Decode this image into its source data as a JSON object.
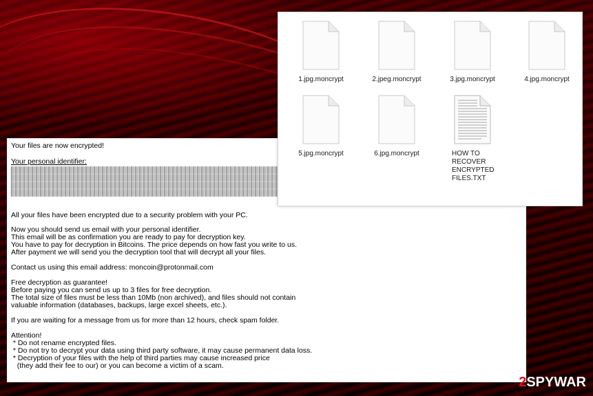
{
  "ransom_note": {
    "heading": "Your files are now encrypted!",
    "identifier_label": "Your personal identifier:",
    "paragraphs": [
      "All your files have been encrypted due to a security problem with your PC.",
      "Now you should send us email with your personal identifier.",
      "This email will be as confirmation you are ready to pay for decryption key.",
      "You have to pay for decryption in Bitcoins. The price depends on how fast you write to us.",
      "After payment we will send you the decryption tool that will decrypt all your files.",
      "Contact us using this email address: moncoin@protonmail.com",
      "Free decryption as guarantee!",
      "Before paying you can send us up to 3 files for free decryption.",
      "The total size of files must be less than 10Mb (non archived), and files should not contain",
      "valuable information (databases, backups, large excel sheets, etc.).",
      "If you are waiting for a message from us for more than 12 hours, check spam folder.",
      "Attention!",
      " * Do not rename encrypted files.",
      " * Do not try to decrypt your data using third party software, it may cause permanent data loss.",
      " * Decryption of your files with the help of third parties may cause increased price",
      "   (they add their fee to our) or you can become a victim of a scam."
    ]
  },
  "files": [
    {
      "name": "1.jpg.moncrypt",
      "icon": "blank-document-icon"
    },
    {
      "name": "2.jpeg.moncrypt",
      "icon": "blank-document-icon"
    },
    {
      "name": "3.jpg.moncrypt",
      "icon": "blank-document-icon"
    },
    {
      "name": "4.jpg.moncrypt",
      "icon": "blank-document-icon"
    },
    {
      "name": "5.jpg.moncrypt",
      "icon": "blank-document-icon"
    },
    {
      "name": "6.jpg.moncrypt",
      "icon": "blank-document-icon"
    },
    {
      "name": "HOW TO RECOVER ENCRYPTED FILES.TXT",
      "icon": "text-document-icon"
    }
  ],
  "watermark": {
    "num": "2",
    "brand": "SPYWAR"
  },
  "colors": {
    "background_red": "#c8000a",
    "logo_red": "#d9131e"
  }
}
